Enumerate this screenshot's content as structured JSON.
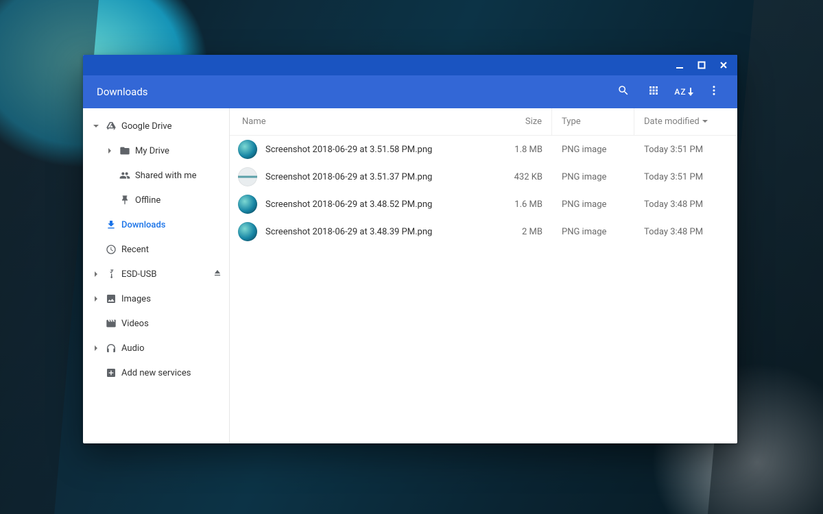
{
  "window": {
    "title": "Downloads"
  },
  "toolbar": {
    "sort_label": "AZ"
  },
  "sidebar": {
    "google_drive": "Google Drive",
    "my_drive": "My Drive",
    "shared_with_me": "Shared with me",
    "offline": "Offline",
    "downloads": "Downloads",
    "recent": "Recent",
    "esd_usb": "ESD-USB",
    "images": "Images",
    "videos": "Videos",
    "audio": "Audio",
    "add_new_services": "Add new services"
  },
  "columns": {
    "name": "Name",
    "size": "Size",
    "type": "Type",
    "date": "Date modified"
  },
  "files": [
    {
      "name": "Screenshot 2018-06-29 at 3.51.58 PM.png",
      "size": "1.8 MB",
      "type": "PNG image",
      "date": "Today 3:51 PM",
      "thumb": "dark"
    },
    {
      "name": "Screenshot 2018-06-29 at 3.51.37 PM.png",
      "size": "432 KB",
      "type": "PNG image",
      "date": "Today 3:51 PM",
      "thumb": "light"
    },
    {
      "name": "Screenshot 2018-06-29 at 3.48.52 PM.png",
      "size": "1.6 MB",
      "type": "PNG image",
      "date": "Today 3:48 PM",
      "thumb": "dark"
    },
    {
      "name": "Screenshot 2018-06-29 at 3.48.39 PM.png",
      "size": "2 MB",
      "type": "PNG image",
      "date": "Today 3:48 PM",
      "thumb": "dark"
    }
  ]
}
